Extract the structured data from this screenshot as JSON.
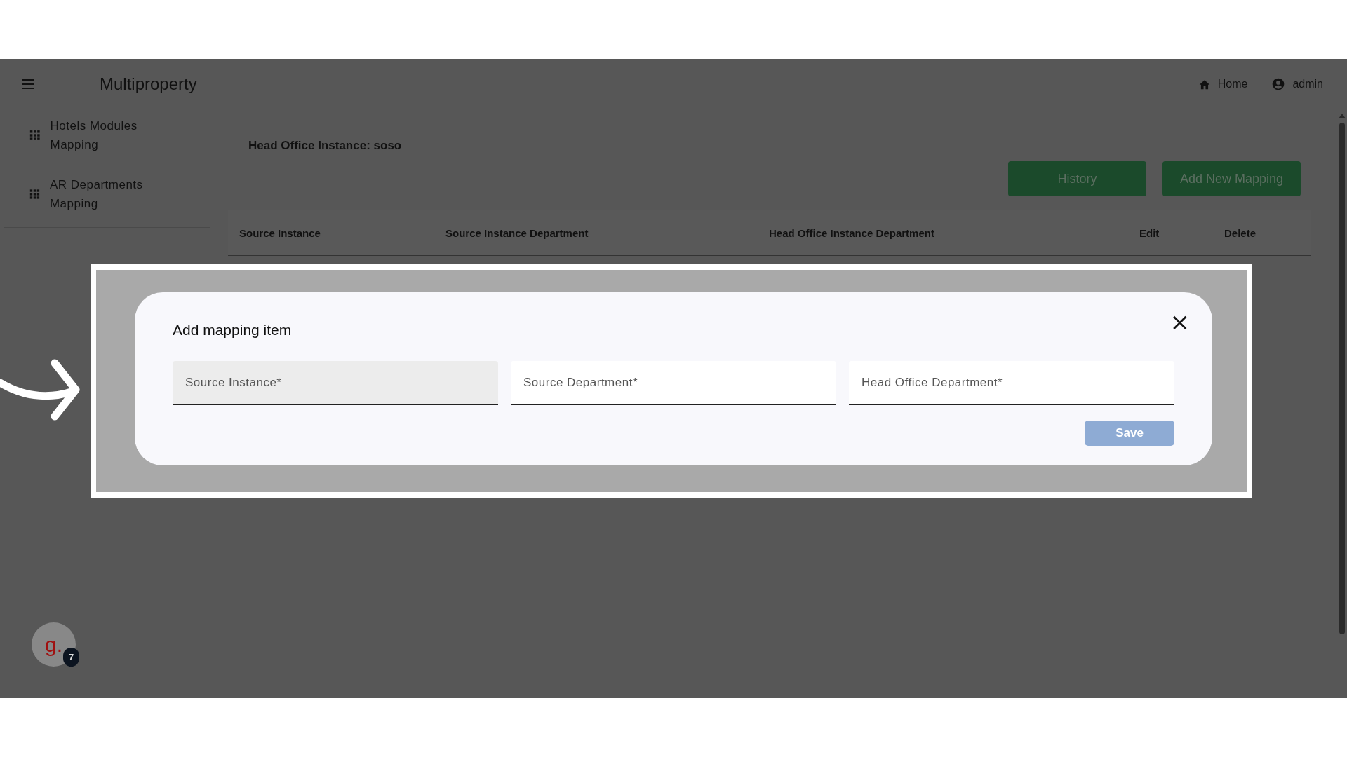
{
  "header": {
    "title": "Multiproperty",
    "links": [
      {
        "kind": "home",
        "label": "Home"
      },
      {
        "kind": "user",
        "label": "admin"
      }
    ]
  },
  "sidebar": {
    "items": [
      {
        "label": "Hotels Modules Mapping"
      },
      {
        "label": "AR Departments Mapping"
      }
    ]
  },
  "content": {
    "heading": "Head Office Instance: soso",
    "buttons": [
      "History",
      "Add New Mapping"
    ],
    "table": {
      "columns": [
        "Source Instance",
        "Source Instance Department",
        "Head Office Instance Department",
        "Edit",
        "Delete"
      ]
    }
  },
  "dialog": {
    "title": "Add mapping item",
    "close": "×",
    "fields": [
      {
        "placeholder": "Source Instance*",
        "focused": true
      },
      {
        "placeholder": "Source Department*",
        "focused": false
      },
      {
        "placeholder": "Head Office Department*",
        "focused": false
      }
    ],
    "save": "Save"
  },
  "chat_widget": {
    "letter": "g.",
    "badge": "7"
  }
}
